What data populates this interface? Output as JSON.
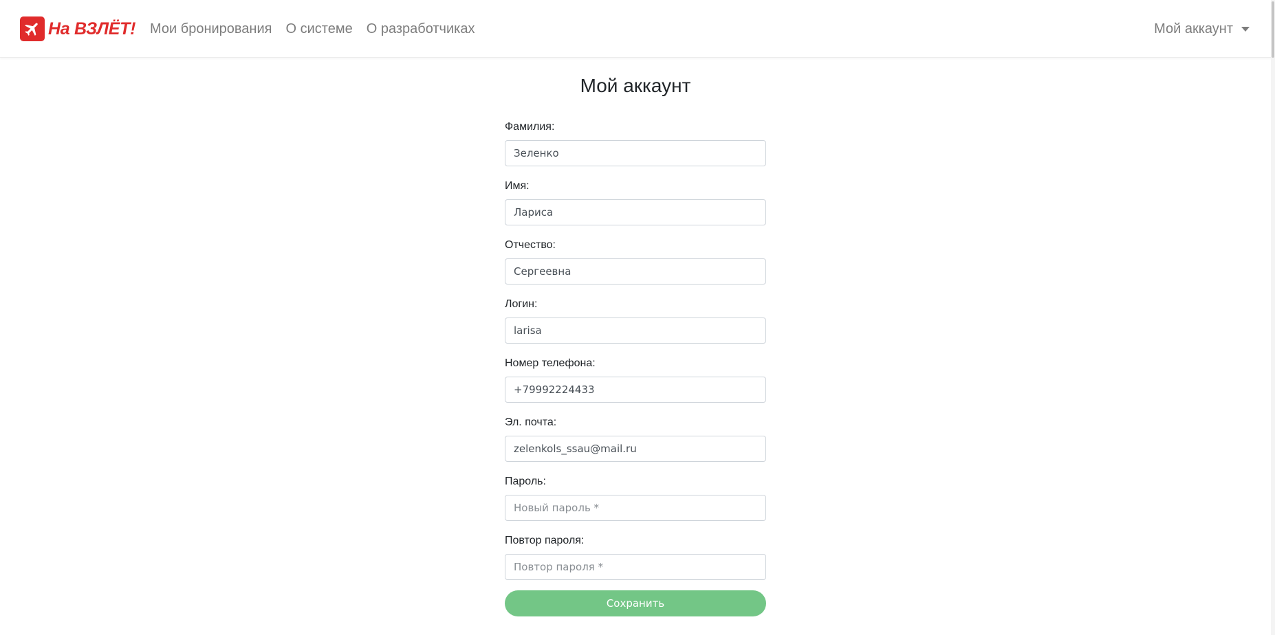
{
  "brand": {
    "logo_icon": "airplane-icon",
    "name": "На ВЗЛЁТ!",
    "color": "#e02b2b"
  },
  "nav": {
    "links": [
      {
        "label": "Мои бронирования"
      },
      {
        "label": "О системе"
      },
      {
        "label": "О разработчиках"
      }
    ],
    "account_label": "Мой аккаунт"
  },
  "page": {
    "title": "Мой аккаунт"
  },
  "form": {
    "fields": [
      {
        "label": "Фамилия:",
        "value": "Зеленко",
        "placeholder": ""
      },
      {
        "label": "Имя:",
        "value": "Лариса",
        "placeholder": ""
      },
      {
        "label": "Отчество:",
        "value": "Сергеевна",
        "placeholder": ""
      },
      {
        "label": "Логин:",
        "value": "larisa",
        "placeholder": ""
      },
      {
        "label": "Номер телефона:",
        "value": "+79992224433",
        "placeholder": ""
      },
      {
        "label": "Эл. почта:",
        "value": "zelenkols_ssau@mail.ru",
        "placeholder": ""
      },
      {
        "label": "Пароль:",
        "value": "",
        "placeholder": "Новый пароль *"
      },
      {
        "label": "Повтор пароля:",
        "value": "",
        "placeholder": "Повтор пароля *"
      }
    ],
    "save_label": "Сохранить",
    "save_color": "#73c686"
  }
}
